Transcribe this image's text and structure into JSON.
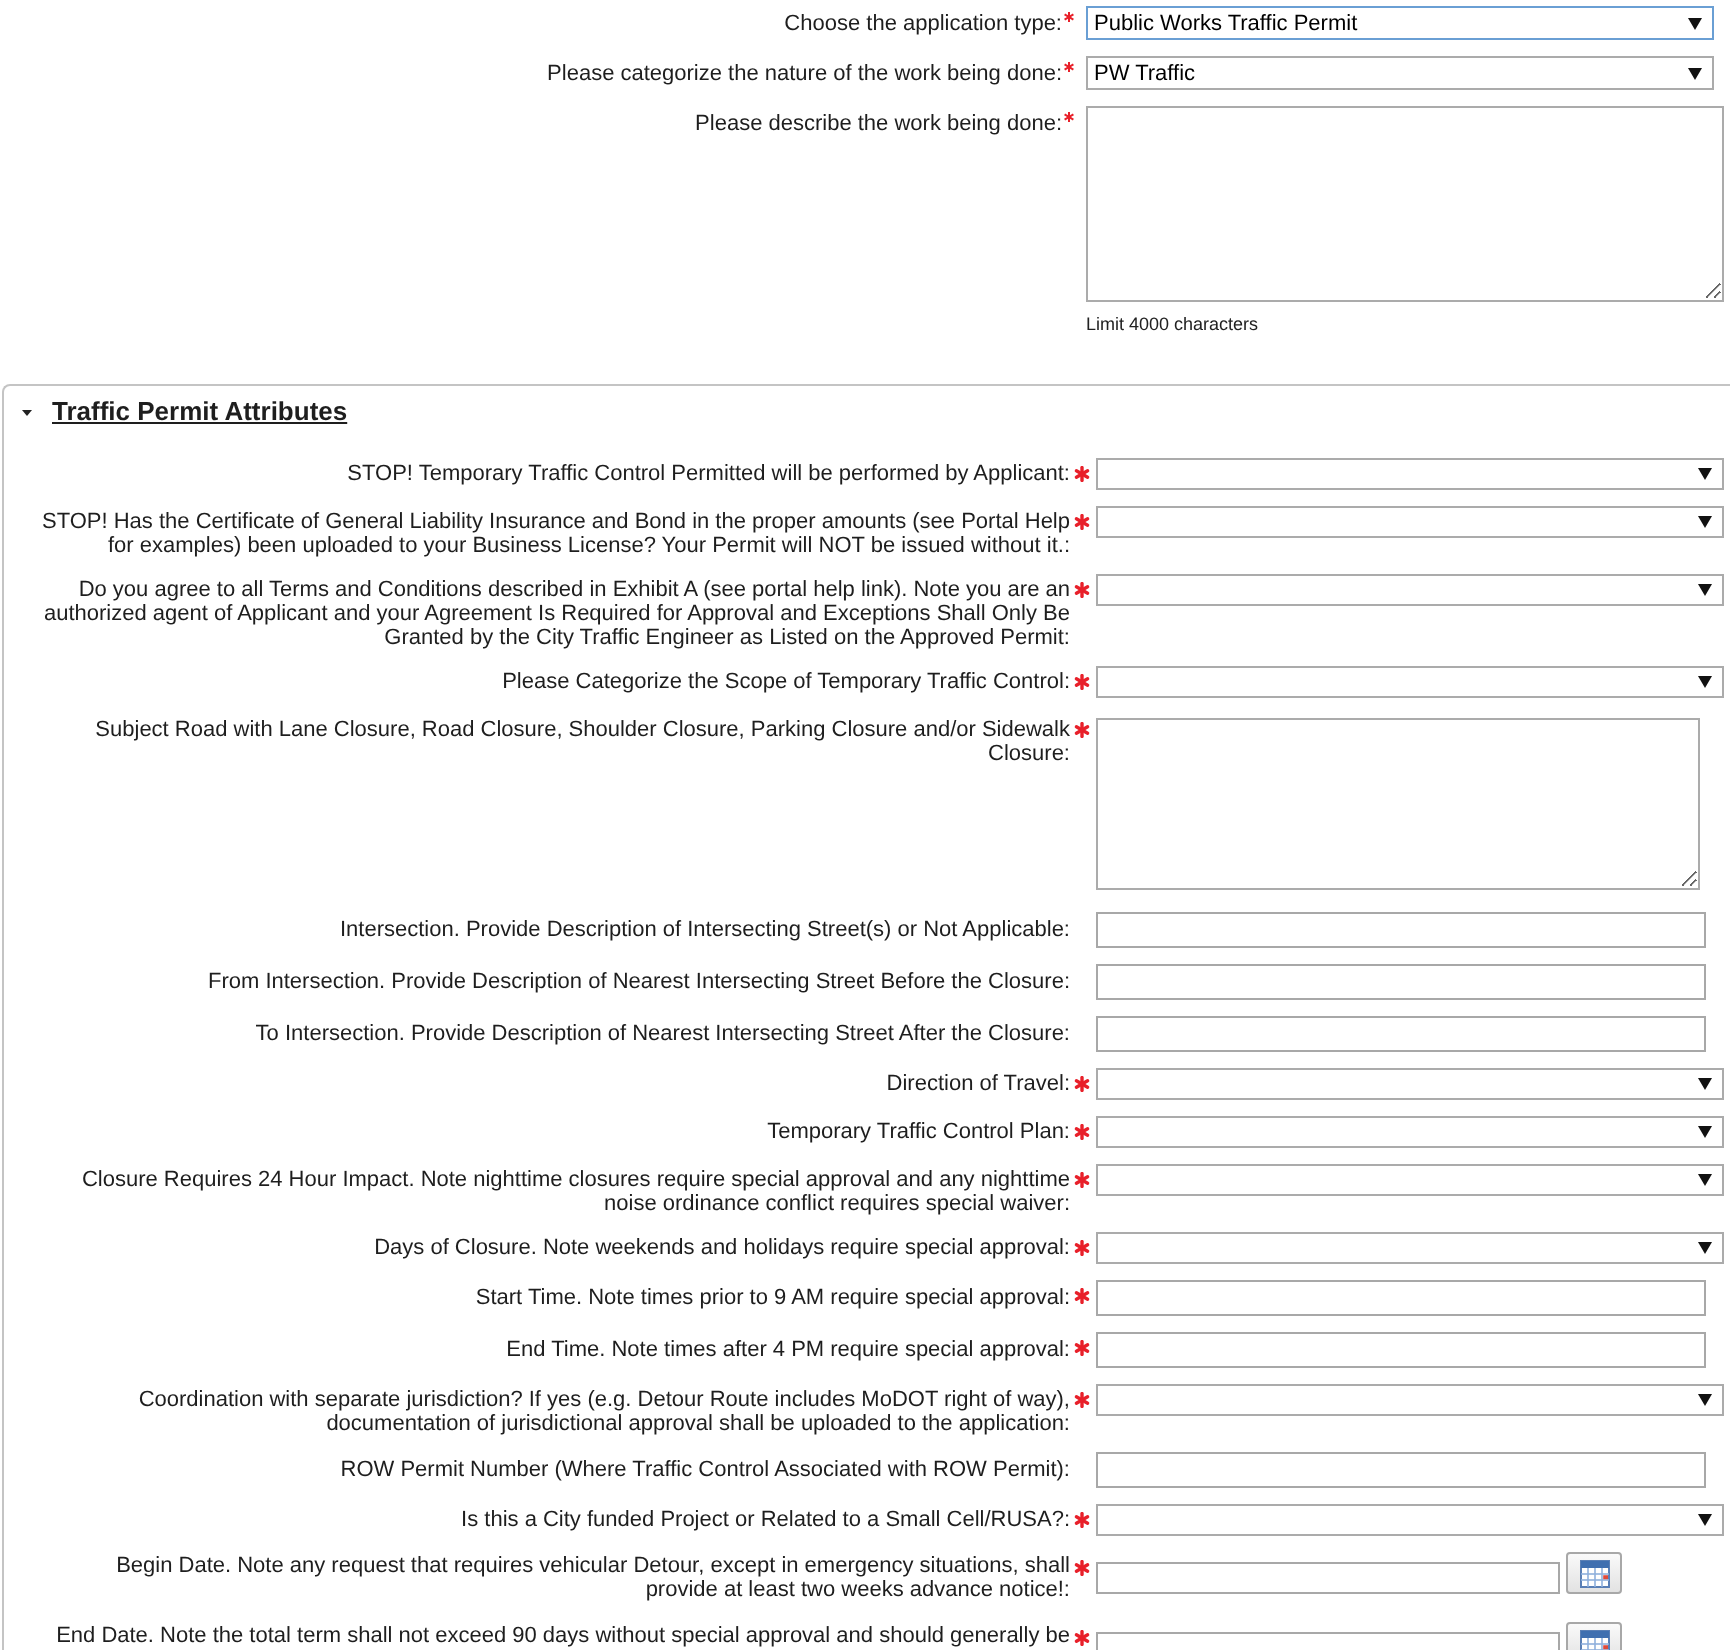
{
  "application": {
    "fields": [
      {
        "kind": "select",
        "label": "Choose the application type:",
        "required": true,
        "focused": true,
        "value": "Public Works Traffic Permit"
      },
      {
        "kind": "select",
        "label": "Please categorize the nature of the work being done:",
        "required": true,
        "focused": false,
        "value": "PW Traffic"
      },
      {
        "kind": "textarea",
        "label": "Please describe the work being done:",
        "required": true,
        "focused": false,
        "hint": "Limit 4000 characters"
      }
    ]
  },
  "section": {
    "title": "Traffic Permit Attributes",
    "expanded": true,
    "fields": [
      {
        "kind": "select",
        "label": "STOP! Temporary Traffic Control Permitted will be performed by Applicant:",
        "required": true
      },
      {
        "kind": "select",
        "label": "STOP! Has the Certificate of General Liability Insurance and Bond in the proper amounts (see Portal Help for examples) been uploaded to your Business License? Your Permit will NOT be issued without it.:",
        "required": true
      },
      {
        "kind": "select",
        "label": "Do you agree to all Terms and Conditions described in Exhibit A (see portal help link). Note you are an authorized agent of Applicant and your Agreement Is Required for Approval and Exceptions Shall Only Be Granted by the City Traffic Engineer as Listed on the Approved Permit:",
        "required": true
      },
      {
        "kind": "select",
        "label": "Please Categorize the Scope of Temporary Traffic Control:",
        "required": true
      },
      {
        "kind": "textarea",
        "label": "Subject Road with Lane Closure, Road Closure, Shoulder Closure, Parking Closure and/or Sidewalk Closure:",
        "required": true
      },
      {
        "kind": "text",
        "label": "Intersection. Provide Description of Intersecting Street(s) or Not Applicable:",
        "required": false
      },
      {
        "kind": "text",
        "label": "From Intersection. Provide Description of Nearest Intersecting Street Before the Closure:",
        "required": false
      },
      {
        "kind": "text",
        "label": "To Intersection. Provide Description of Nearest Intersecting Street After the Closure:",
        "required": false
      },
      {
        "kind": "select",
        "label": "Direction of Travel:",
        "required": true
      },
      {
        "kind": "select",
        "label": "Temporary Traffic Control Plan:",
        "required": true
      },
      {
        "kind": "select",
        "label": "Closure Requires 24 Hour Impact. Note nighttime closures require special approval and any nighttime noise ordinance conflict requires special waiver:",
        "required": true
      },
      {
        "kind": "select",
        "label": "Days of Closure. Note weekends and holidays require special approval:",
        "required": true
      },
      {
        "kind": "text",
        "label": "Start Time. Note times prior to 9 AM require special approval:",
        "required": true
      },
      {
        "kind": "text",
        "label": "End Time. Note times after 4 PM require special approval:",
        "required": true
      },
      {
        "kind": "select",
        "label": "Coordination with separate jurisdiction? If yes (e.g. Detour Route includes MoDOT right of way), documentation of jurisdictional approval shall be uploaded to the application:",
        "required": true
      },
      {
        "kind": "text",
        "label": "ROW Permit Number (Where Traffic Control Associated with ROW Permit):",
        "required": false
      },
      {
        "kind": "select",
        "label": "Is this a City funded Project or Related to a Small Cell/RUSA?:",
        "required": true
      },
      {
        "kind": "date",
        "label": "Begin Date. Note any request that requires vehicular Detour, except in emergency situations, shall provide at least two weeks advance notice!:",
        "required": true
      },
      {
        "kind": "date",
        "label": "End Date. Note the total term shall not exceed 90 days without special approval and should generally be",
        "required": true
      }
    ]
  }
}
